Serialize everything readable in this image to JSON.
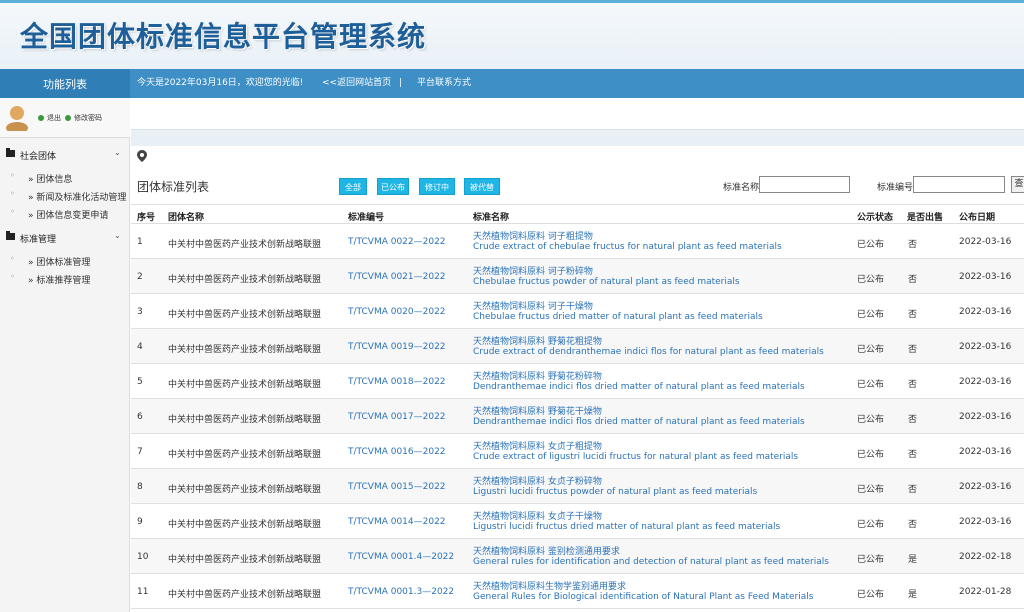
{
  "header": {
    "title": "全国团体标准信息平台管理系统"
  },
  "nav": {
    "left_title": "功能列表",
    "welcome": "今天是2022年03月16日，欢迎您的光临!",
    "back_link": "<<返回网站首页",
    "separator": "|",
    "contact_link": "平台联系方式"
  },
  "user": {
    "logout": "退出",
    "change_password": "修改密码"
  },
  "sidebar": {
    "sections": [
      {
        "title": "社会团体",
        "items": [
          "» 团体信息",
          "» 新闻及标准化活动管理",
          "» 团体信息变更申请"
        ]
      },
      {
        "title": "标准管理",
        "items": [
          "» 团体标准管理",
          "» 标准推荐管理"
        ]
      }
    ]
  },
  "list": {
    "title": "团体标准列表",
    "filters": [
      "全部",
      "已公布",
      "修订中",
      "被代替"
    ],
    "search_name_label": "标准名称",
    "search_code_label": "标准编号",
    "search_name_value": "",
    "search_code_value": "",
    "search_button": "查"
  },
  "table": {
    "headers": [
      "序号",
      "团体名称",
      "标准编号",
      "标准名称",
      "公示状态",
      "是否出售",
      "公布日期"
    ],
    "rows": [
      {
        "no": "1",
        "org": "中关村中兽医药产业技术创新战略联盟",
        "code": "T/TCVMA 0022—2022",
        "name_cn": "天然植物饲料原料 诃子粗提物",
        "name_en": "Crude extract of chebulae fructus for natural plant as feed materials",
        "status": "已公布",
        "sale": "否",
        "date": "2022-03-16"
      },
      {
        "no": "2",
        "org": "中关村中兽医药产业技术创新战略联盟",
        "code": "T/TCVMA 0021—2022",
        "name_cn": "天然植物饲料原料 诃子粉碎物",
        "name_en": "Chebulae fructus powder of natural plant as feed materials",
        "status": "已公布",
        "sale": "否",
        "date": "2022-03-16"
      },
      {
        "no": "3",
        "org": "中关村中兽医药产业技术创新战略联盟",
        "code": "T/TCVMA 0020—2022",
        "name_cn": "天然植物饲料原料 诃子干燥物",
        "name_en": "Chebulae fructus dried matter of natural plant as feed materials",
        "status": "已公布",
        "sale": "否",
        "date": "2022-03-16"
      },
      {
        "no": "4",
        "org": "中关村中兽医药产业技术创新战略联盟",
        "code": "T/TCVMA 0019—2022",
        "name_cn": "天然植物饲料原料 野菊花粗提物",
        "name_en": "Crude extract of dendranthemae indici flos for natural plant as feed materials",
        "status": "已公布",
        "sale": "否",
        "date": "2022-03-16"
      },
      {
        "no": "5",
        "org": "中关村中兽医药产业技术创新战略联盟",
        "code": "T/TCVMA 0018—2022",
        "name_cn": "天然植物饲料原料 野菊花粉碎物",
        "name_en": "Dendranthemae indici flos dried matter of natural plant as feed materials",
        "status": "已公布",
        "sale": "否",
        "date": "2022-03-16"
      },
      {
        "no": "6",
        "org": "中关村中兽医药产业技术创新战略联盟",
        "code": "T/TCVMA 0017—2022",
        "name_cn": "天然植物饲料原料 野菊花干燥物",
        "name_en": "Dendranthemae indici flos dried matter of natural plant as feed materials",
        "status": "已公布",
        "sale": "否",
        "date": "2022-03-16"
      },
      {
        "no": "7",
        "org": "中关村中兽医药产业技术创新战略联盟",
        "code": "T/TCVMA 0016—2022",
        "name_cn": "天然植物饲料原料 女贞子粗提物",
        "name_en": "Crude extract of ligustri lucidi fructus for natural plant as feed materials",
        "status": "已公布",
        "sale": "否",
        "date": "2022-03-16"
      },
      {
        "no": "8",
        "org": "中关村中兽医药产业技术创新战略联盟",
        "code": "T/TCVMA 0015—2022",
        "name_cn": "天然植物饲料原料 女贞子粉碎物",
        "name_en": "Ligustri lucidi fructus powder of natural plant as feed materials",
        "status": "已公布",
        "sale": "否",
        "date": "2022-03-16"
      },
      {
        "no": "9",
        "org": "中关村中兽医药产业技术创新战略联盟",
        "code": "T/TCVMA 0014—2022",
        "name_cn": "天然植物饲料原料 女贞子干燥物",
        "name_en": "Ligustri lucidi fructus dried matter of natural plant as feed materials",
        "status": "已公布",
        "sale": "否",
        "date": "2022-03-16"
      },
      {
        "no": "10",
        "org": "中关村中兽医药产业技术创新战略联盟",
        "code": "T/TCVMA 0001.4—2022",
        "name_cn": "天然植物饲料原料 鉴别检测通用要求",
        "name_en": "General rules for identification and detection of natural plant as feed materials",
        "status": "已公布",
        "sale": "是",
        "date": "2022-02-18"
      },
      {
        "no": "11",
        "org": "中关村中兽医药产业技术创新战略联盟",
        "code": "T/TCVMA 0001.3—2022",
        "name_cn": "天然植物饲料原料生物学鉴别通用要求",
        "name_en": "General Rules for Biological identification of Natural Plant as Feed Materials",
        "status": "已公布",
        "sale": "是",
        "date": "2022-01-28"
      }
    ]
  }
}
